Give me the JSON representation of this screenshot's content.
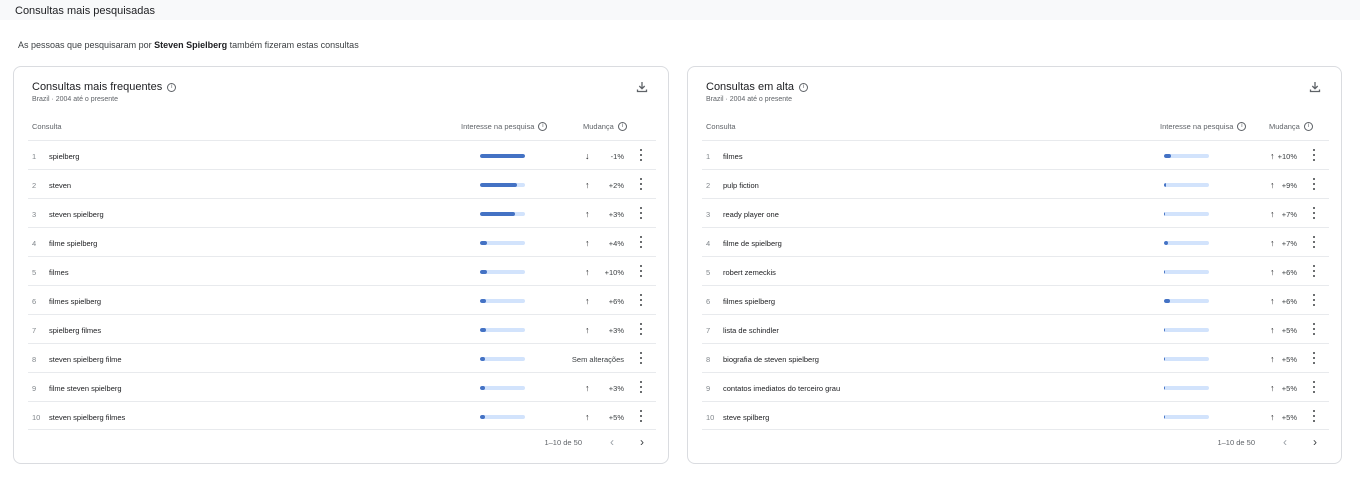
{
  "page": {
    "title": "Consultas mais pesquisadas",
    "subtitle_prefix": "As pessoas que pesquisaram por",
    "subtitle_term": "Steven Spielberg",
    "subtitle_suffix": "também fizeram estas consultas"
  },
  "left": {
    "title": "Consultas mais frequentes",
    "meta": "Brazil · 2004 até o presente",
    "col_query": "Consulta",
    "col_interest": "Interesse na pesquisa",
    "col_change": "Mudança",
    "pager_range": "1–10 de 50",
    "rows": [
      {
        "rank": "1",
        "query": "spielberg",
        "interest": 100,
        "arrow": "↓",
        "change": "-1%"
      },
      {
        "rank": "2",
        "query": "steven",
        "interest": 82,
        "arrow": "↑",
        "change": "+2%"
      },
      {
        "rank": "3",
        "query": "steven spielberg",
        "interest": 78,
        "arrow": "↑",
        "change": "+3%"
      },
      {
        "rank": "4",
        "query": "filme spielberg",
        "interest": 15,
        "arrow": "↑",
        "change": "+4%"
      },
      {
        "rank": "5",
        "query": "filmes",
        "interest": 15,
        "arrow": "↑",
        "change": "+10%"
      },
      {
        "rank": "6",
        "query": "filmes spielberg",
        "interest": 14,
        "arrow": "↑",
        "change": "+6%"
      },
      {
        "rank": "7",
        "query": "spielberg filmes",
        "interest": 13,
        "arrow": "↑",
        "change": "+3%"
      },
      {
        "rank": "8",
        "query": "steven spielberg filme",
        "interest": 10,
        "arrow": "",
        "change": "Sem alterações"
      },
      {
        "rank": "9",
        "query": "filme steven spielberg",
        "interest": 10,
        "arrow": "↑",
        "change": "+3%"
      },
      {
        "rank": "10",
        "query": "steven spielberg filmes",
        "interest": 10,
        "arrow": "↑",
        "change": "+5%"
      }
    ]
  },
  "right": {
    "title": "Consultas em alta",
    "meta": "Brazil · 2004 até o presente",
    "col_query": "Consulta",
    "col_interest": "Interesse na pesquisa",
    "col_change": "Mudança",
    "pager_range": "1–10 de 50",
    "rows": [
      {
        "rank": "1",
        "query": "filmes",
        "interest": 15,
        "arrow": "↑",
        "change": "+10%"
      },
      {
        "rank": "2",
        "query": "pulp fiction",
        "interest": 4,
        "arrow": "↑",
        "change": "+9%"
      },
      {
        "rank": "3",
        "query": "ready player one",
        "interest": 3,
        "arrow": "↑",
        "change": "+7%"
      },
      {
        "rank": "4",
        "query": "filme de spielberg",
        "interest": 9,
        "arrow": "↑",
        "change": "+7%"
      },
      {
        "rank": "5",
        "query": "robert zemeckis",
        "interest": 3,
        "arrow": "↑",
        "change": "+6%"
      },
      {
        "rank": "6",
        "query": "filmes spielberg",
        "interest": 14,
        "arrow": "↑",
        "change": "+6%"
      },
      {
        "rank": "7",
        "query": "lista de schindler",
        "interest": 3,
        "arrow": "↑",
        "change": "+5%"
      },
      {
        "rank": "8",
        "query": "biografia de steven spielberg",
        "interest": 3,
        "arrow": "↑",
        "change": "+5%"
      },
      {
        "rank": "9",
        "query": "contatos imediatos do terceiro grau",
        "interest": 3,
        "arrow": "↑",
        "change": "+5%"
      },
      {
        "rank": "10",
        "query": "steve spilberg",
        "interest": 3,
        "arrow": "↑",
        "change": "+5%"
      }
    ]
  },
  "colors": {
    "bar_fill": "#4472c4",
    "bar_track": "#d2e3fc"
  },
  "icons": {
    "download": "download-icon",
    "info": "info-icon",
    "more": "more-vert-icon",
    "prev": "chevron-left-icon",
    "next": "chevron-right-icon"
  }
}
